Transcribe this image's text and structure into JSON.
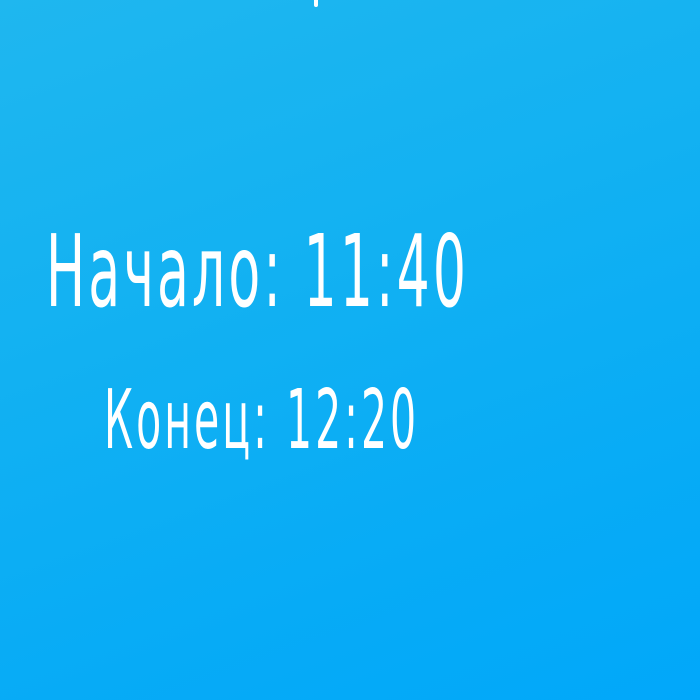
{
  "schedule": {
    "start_text": "Начало: 11:40",
    "end_text": "Конец: 12:20"
  },
  "colors": {
    "background_start": "#1fb7ef",
    "background_end": "#01a8fa",
    "text": "#ffffff"
  }
}
